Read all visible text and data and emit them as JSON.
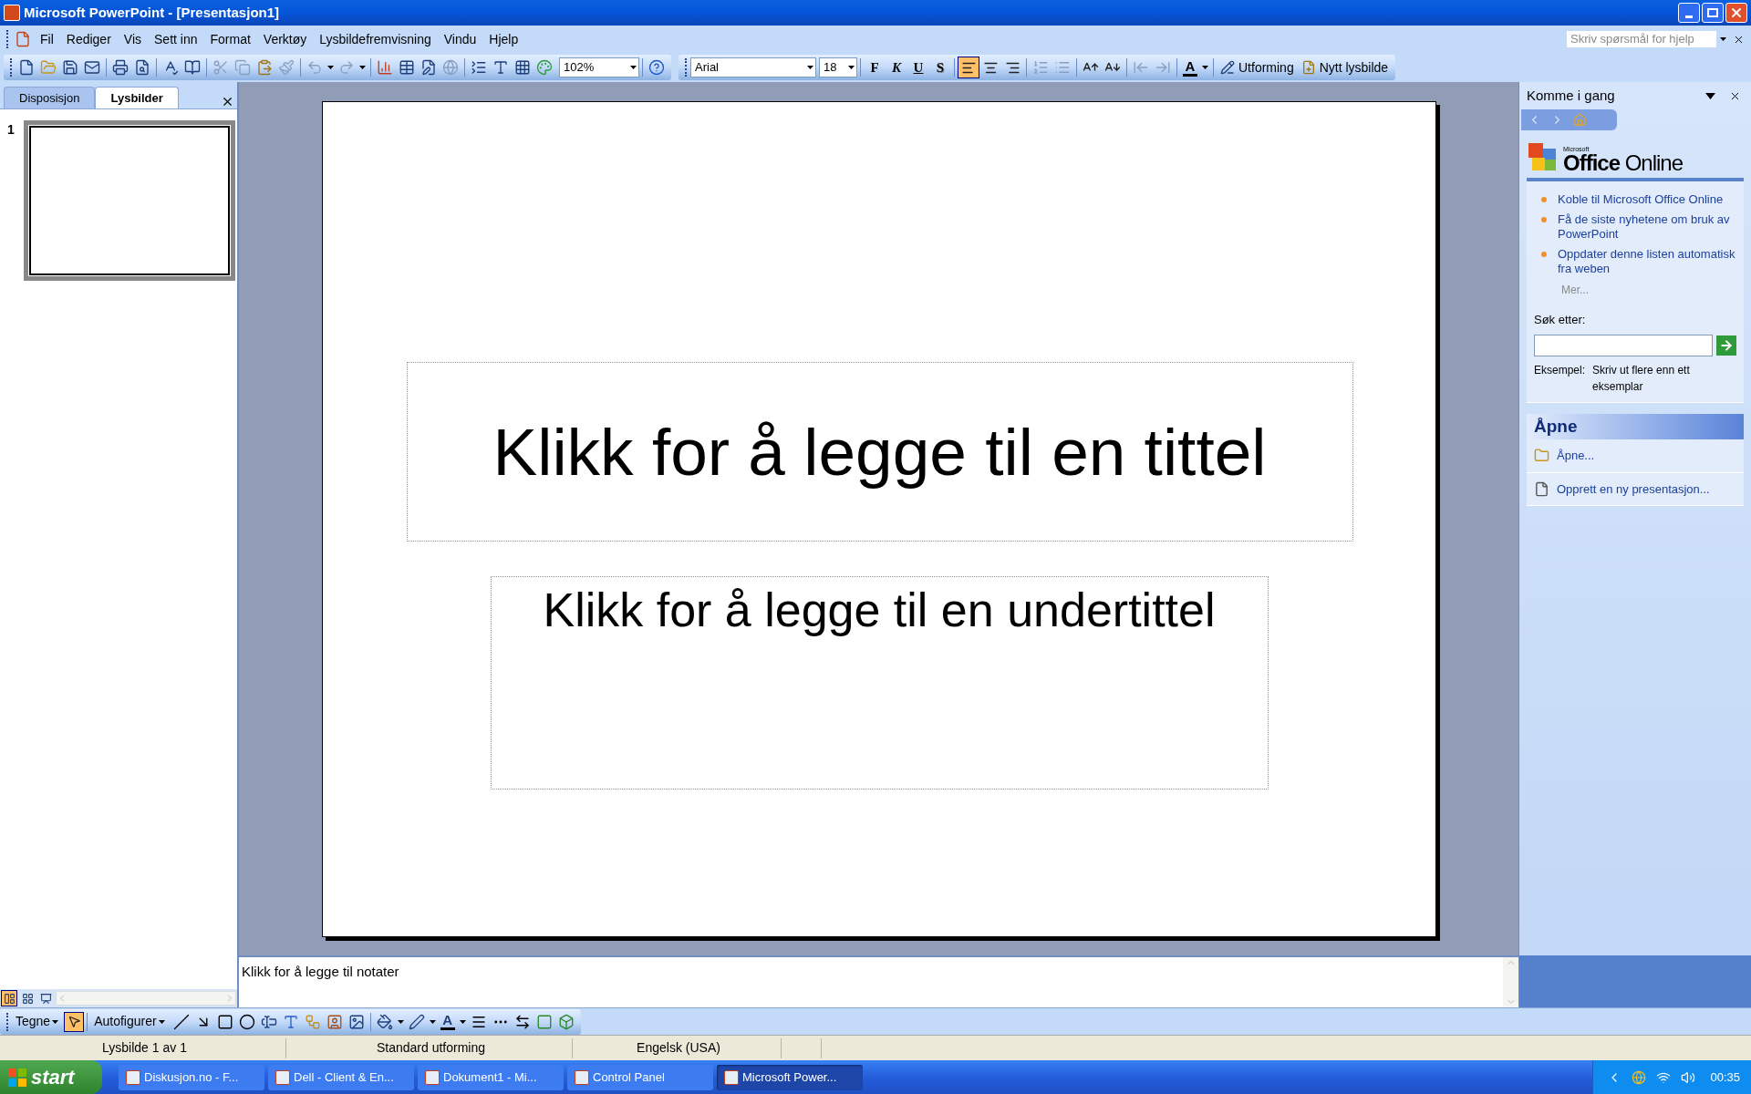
{
  "window": {
    "title": "Microsoft PowerPoint - [Presentasjon1]"
  },
  "menu": [
    "Fil",
    "Rediger",
    "Vis",
    "Sett inn",
    "Format",
    "Verktøy",
    "Lysbildefremvisning",
    "Vindu",
    "Hjelp"
  ],
  "help_search": {
    "placeholder": "Skriv spørsmål for hjelp"
  },
  "standard_toolbar": {
    "zoom": "102%"
  },
  "formatting_toolbar": {
    "font": "Arial",
    "size": "18",
    "styles": [
      "F",
      "K",
      "U",
      "S"
    ],
    "align": [
      {
        "selected": true
      },
      {
        "selected": false
      },
      {
        "selected": false
      }
    ],
    "font_color_glyph": "A",
    "buttons": [
      "Utforming",
      "Nytt lysbilde"
    ]
  },
  "pane_tabs": [
    {
      "label": "Disposisjon",
      "selected": false
    },
    {
      "label": "Lysbilder",
      "selected": true
    }
  ],
  "thumbnails": [
    {
      "number": "1",
      "selected": true
    }
  ],
  "slide": {
    "title": "Klikk for å legge til en tittel",
    "subtitle": "Klikk for å legge til en undertittel"
  },
  "notes": {
    "text": "Klikk for å legge til notater"
  },
  "view_buttons": [
    {
      "selected": true
    },
    {
      "selected": false
    },
    {
      "selected": false
    }
  ],
  "task_pane": {
    "title": "Komme i gang",
    "logo_small": "Microsoft",
    "logo": "**Office** Online",
    "links": [
      "Koble til Microsoft Office Online",
      "Få de siste nyhetene om bruk av PowerPoint",
      "Oppdater denne listen automatisk fra weben"
    ],
    "more": "Mer...",
    "search_label": "Søk etter:",
    "example_label": "Eksempel:",
    "example_text": "Skriv ut flere enn ett eksemplar",
    "open_heading": "Åpne",
    "open_items": [
      "Åpne...",
      "Opprett en ny presentasjon..."
    ]
  },
  "drawing_toolbar": {
    "draw_menu": "Tegne",
    "autoshapes": "Autofigurer",
    "font_color_glyph": "A"
  },
  "status_bar": [
    "Lysbilde 1 av 1",
    "Standard utforming",
    "Engelsk (USA)"
  ],
  "taskbar": {
    "start": "start",
    "items": [
      {
        "label": "Diskusjon.no - F...",
        "selected": false
      },
      {
        "label": "Dell - Client & En...",
        "selected": false
      },
      {
        "label": "Dokument1 - Mi...",
        "selected": false
      },
      {
        "label": "Control Panel",
        "selected": false
      },
      {
        "label": "Microsoft Power...",
        "selected": true
      }
    ],
    "clock": "00:35"
  }
}
